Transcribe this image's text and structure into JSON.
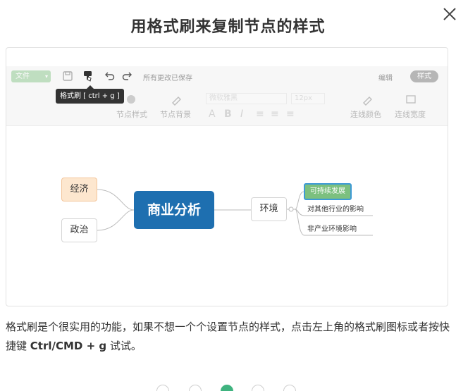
{
  "dialog": {
    "title": "用格式刷来复制节点的样式",
    "description": "格式刷是个很实用的功能，如果不想一个个设置节点的样式，点击左上角的格式刷图标或者按快捷键",
    "shortcut": "Ctrl/CMD + g",
    "description_tail": " 试试。",
    "page_index": 3,
    "page_count": 5
  },
  "preview": {
    "toolbar": {
      "file_label": "文件",
      "autosave_text": "所有更改已保存",
      "edit_label": "编辑",
      "style_label": "样式",
      "tooltip": "格式刷 [ ctrl + g ]",
      "node_style_label": "节点样式",
      "node_bg_label": "节点背景",
      "font_name": "微软雅黑",
      "font_size": "12px",
      "line_color_label": "连线颜色",
      "line_width_label": "连线宽度"
    },
    "mindmap": {
      "root": "商业分析",
      "left_nodes": [
        "经济",
        "政治"
      ],
      "right_node": "环境",
      "right_children": [
        "可持续发展",
        "对其他行业的影响",
        "非产业环境影响"
      ]
    }
  },
  "colors": {
    "accent_green": "#3fb37f",
    "root_blue": "#1e6fb0",
    "highlight_green": "#7cc07f",
    "econ_fill": "#fde7cf"
  }
}
